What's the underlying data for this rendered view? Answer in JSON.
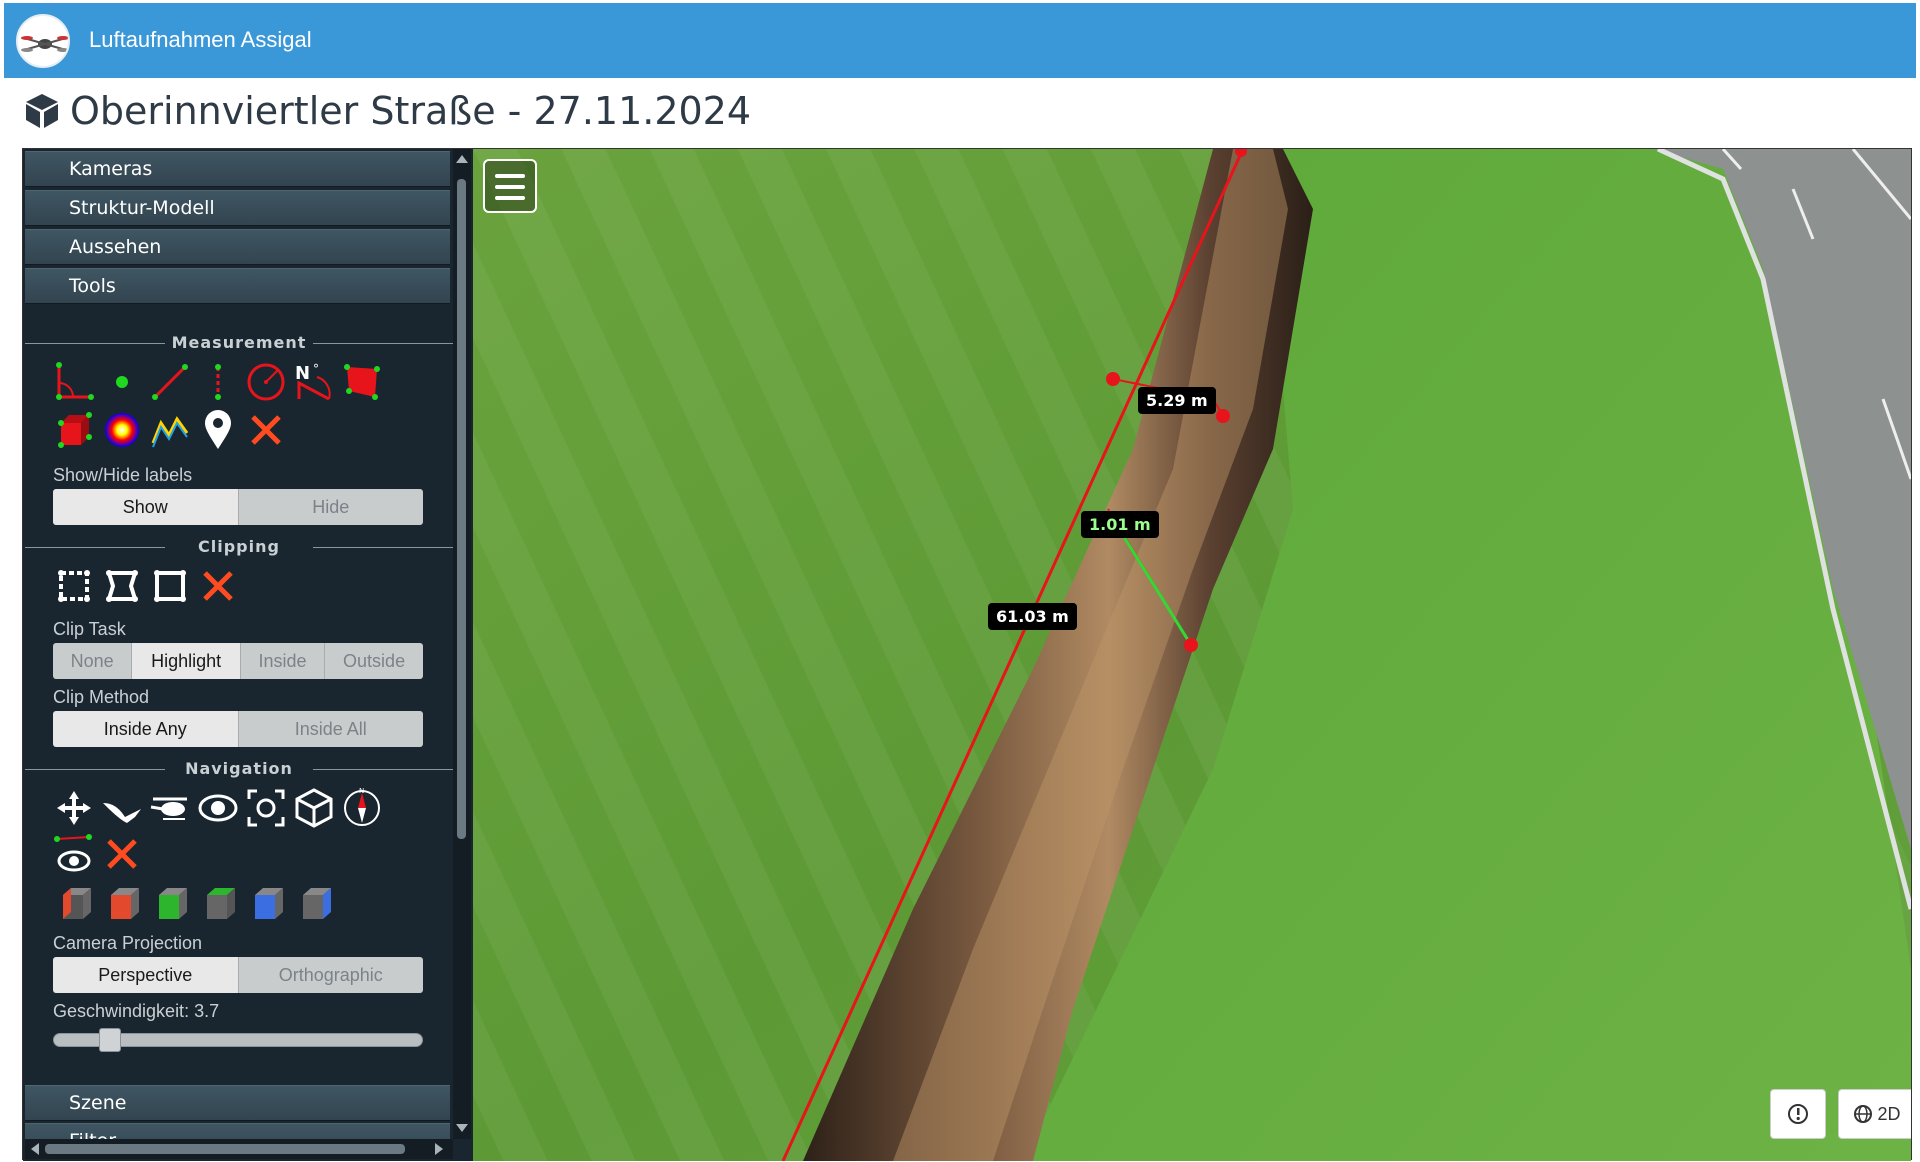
{
  "app": {
    "title": "Luftaufnahmen Assigal"
  },
  "page": {
    "title": "Oberinnviertler Straße - 27.11.2024"
  },
  "sidebar": {
    "accordion": [
      {
        "label": "Kameras"
      },
      {
        "label": "Struktur-Modell"
      },
      {
        "label": "Aussehen"
      },
      {
        "label": "Tools"
      }
    ],
    "bottom_accordion": [
      {
        "label": "Szene"
      },
      {
        "label": "Filter"
      }
    ],
    "measurement": {
      "title": "Measurement",
      "tools": [
        "angle-icon",
        "point-icon",
        "distance-icon",
        "height-icon",
        "circle-icon",
        "azimuth-icon",
        "area-icon",
        "volume-icon",
        "sphere-volume-icon",
        "profile-icon",
        "annotation-icon",
        "remove-all-icon"
      ],
      "labels_title": "Show/Hide labels",
      "labels_options": [
        "Show",
        "Hide"
      ],
      "labels_selected": "Show"
    },
    "clipping": {
      "title": "Clipping",
      "tools": [
        "clip-box-icon",
        "clip-polygon-icon",
        "clip-plane-icon",
        "remove-clip-icon"
      ],
      "task_title": "Clip Task",
      "task_options": [
        "None",
        "Highlight",
        "Inside",
        "Outside"
      ],
      "task_selected": "Highlight",
      "method_title": "Clip Method",
      "method_options": [
        "Inside Any",
        "Inside All"
      ],
      "method_selected": "Inside Any"
    },
    "navigation": {
      "title": "Navigation",
      "tools": [
        "earth-control-icon",
        "fly-control-icon",
        "heli-control-icon",
        "orbit-control-icon",
        "focus-icon",
        "cube-view-icon",
        "compass-icon",
        "camera-animation-icon",
        "remove-icon"
      ],
      "views": [
        "left-view-icon",
        "front-view-icon",
        "top-view-icon",
        "back-view-icon",
        "right-view-icon",
        "bottom-view-icon"
      ],
      "projection_title": "Camera Projection",
      "projection_options": [
        "Perspective",
        "Orthographic"
      ],
      "projection_selected": "Perspective",
      "speed_label": "Geschwindigkeit: 3.7",
      "speed_fraction": 0.13
    }
  },
  "map": {
    "measurements": [
      {
        "label": "5.29 m"
      },
      {
        "label": "1.01 m"
      },
      {
        "label": "61.03 m"
      }
    ],
    "buttons": {
      "info_icon": "info-icon",
      "mode_label": "2D"
    }
  },
  "colors": {
    "header": "#3a98d9",
    "measure_line": "#e8141b",
    "height_line": "#33d933",
    "grass": "#5f9e3a",
    "trench": "#4a3526"
  }
}
